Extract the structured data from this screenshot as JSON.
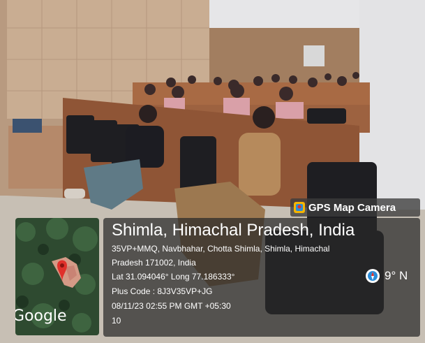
{
  "badge": {
    "label": "GPS Map Camera",
    "icon": "gps-map-camera-icon"
  },
  "map": {
    "brand": "Google",
    "pin_color": "#e0312b"
  },
  "location": {
    "title": "Shimla, Himachal Pradesh, India",
    "address_line1": "35VP+MMQ, Navbhahar, Chotta Shimla, Shimla, Himachal",
    "address_line2": "Pradesh 171002, India",
    "coords": "Lat 31.094046° Long 77.186333°",
    "plus_code": "Plus Code : 8J3V35VP+JG",
    "datetime": "08/11/23 02:55 PM GMT +05:30",
    "extra": "10"
  },
  "compass": {
    "reading": "9° N",
    "icon": "compass-icon"
  },
  "colors": {
    "overlay": "#282828",
    "accent": "#2a8cd8"
  }
}
